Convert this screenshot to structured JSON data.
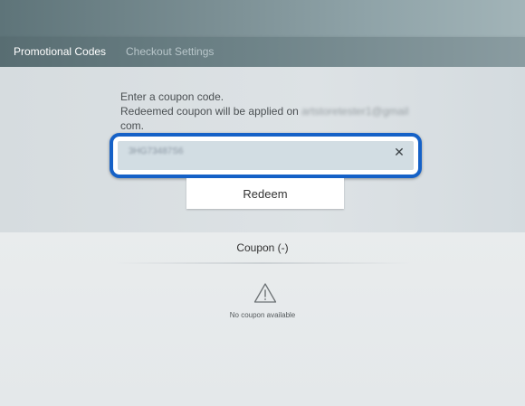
{
  "tabs": [
    {
      "label": "Promotional Codes",
      "active": true
    },
    {
      "label": "Checkout Settings",
      "active": false
    }
  ],
  "instructions": {
    "line1": "Enter a coupon code.",
    "line2_prefix": "Redeemed coupon will be applied on",
    "email_blurred": "artstoretester1@gmail",
    "line3": "com."
  },
  "coupon_input": {
    "value": "3HG73487S6",
    "clear_icon": "close-icon",
    "clear_glyph": "✕",
    "highlight_color": "#1561c7"
  },
  "redeem_button": {
    "label": "Redeem"
  },
  "coupon_list": {
    "header": "Coupon (-)",
    "empty_icon": "warning-icon",
    "empty_text": "No coupon available"
  }
}
